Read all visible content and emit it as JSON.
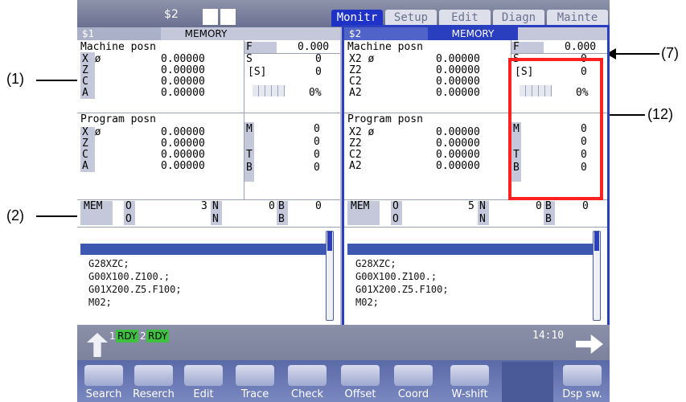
{
  "header": {
    "system_label": "$2",
    "tabs": [
      "Monitr",
      "Setup",
      "Edit",
      "Diagn",
      "Mainte"
    ],
    "active_tab": "Monitr"
  },
  "callouts": {
    "c1": "(1)",
    "c2": "(2)",
    "c7": "(7)",
    "c12": "(12)"
  },
  "left_panel": {
    "system": "$1",
    "mode": "MEMORY",
    "machine_posn_title": "Machine posn",
    "machine_axes": [
      {
        "name": "X ø",
        "value": "0.00000"
      },
      {
        "name": "Z",
        "value": "0.00000"
      },
      {
        "name": "C",
        "value": "0.00000"
      },
      {
        "name": "A",
        "value": "0.00000"
      }
    ],
    "program_posn_title": "Program posn",
    "program_axes": [
      {
        "name": "X ø",
        "value": "0.00000"
      },
      {
        "name": "Z",
        "value": "0.00000"
      },
      {
        "name": "C",
        "value": "0.00000"
      },
      {
        "name": "A",
        "value": "0.00000"
      }
    ],
    "f_label": "F",
    "f_value": "0.000",
    "s_label": "S",
    "s_value": "0",
    "ss_label": "[S]",
    "ss_value": "0",
    "load_percent": "0%",
    "m_label": "M",
    "m_values": [
      "0",
      "0"
    ],
    "t_label": "T",
    "t_value": "0",
    "b_label": "B",
    "b_value": "0",
    "mem": {
      "mode": "MEM",
      "o_label": "O",
      "o_value": "3",
      "n_label": "N",
      "n_value": "0",
      "b_label": "B",
      "b_value": "0",
      "o2_label": "O",
      "n2_label": "N",
      "b2_label": "B"
    },
    "program_lines": [
      "G28XZC;",
      "G00X100.Z100.;",
      "G01X200.Z5.F100;",
      "M02;"
    ]
  },
  "right_panel": {
    "system": "$2",
    "mode": "MEMORY",
    "machine_posn_title": "Machine posn",
    "machine_axes": [
      {
        "name": "X2 ø",
        "value": "0.00000"
      },
      {
        "name": "Z2",
        "value": "0.00000"
      },
      {
        "name": "C2",
        "value": "0.00000"
      },
      {
        "name": "A2",
        "value": "0.00000"
      }
    ],
    "program_posn_title": "Program posn",
    "program_axes": [
      {
        "name": "X2 ø",
        "value": "0.00000"
      },
      {
        "name": "Z2",
        "value": "0.00000"
      },
      {
        "name": "C2",
        "value": "0.00000"
      },
      {
        "name": "A2",
        "value": "0.00000"
      }
    ],
    "f_label": "F",
    "f_value": "0.000",
    "s_label": "S",
    "s_value": "0",
    "ss_label": "[S]",
    "ss_value": "0",
    "load_percent": "0%",
    "m_label": "M",
    "m_values": [
      "0",
      "0"
    ],
    "t_label": "T",
    "t_value": "0",
    "b_label": "B",
    "b_value": "0",
    "mem": {
      "mode": "MEM",
      "o_label": "O",
      "o_value": "5",
      "n_label": "N",
      "n_value": "0",
      "b_label": "B",
      "b_value": "0",
      "o2_label": "O",
      "n2_label": "N",
      "b2_label": "B"
    },
    "program_lines": [
      "G28XZC;",
      "G00X100.Z100.;",
      "G01X200.Z5.F100;",
      "M02;"
    ]
  },
  "status": {
    "sys1_num": "1",
    "sys1_state": "RDY",
    "sys2_num": "2",
    "sys2_state": "RDY",
    "time": "14:10"
  },
  "menu_keys": [
    "Search",
    "Reserch",
    "Edit",
    "Trace",
    "Check",
    "Offset",
    "Coord",
    "W-shift",
    "",
    "Dsp sw."
  ],
  "colors": {
    "accent": "#1e32c8",
    "highlight_box": "#ff2020",
    "ready": "#40c040"
  }
}
